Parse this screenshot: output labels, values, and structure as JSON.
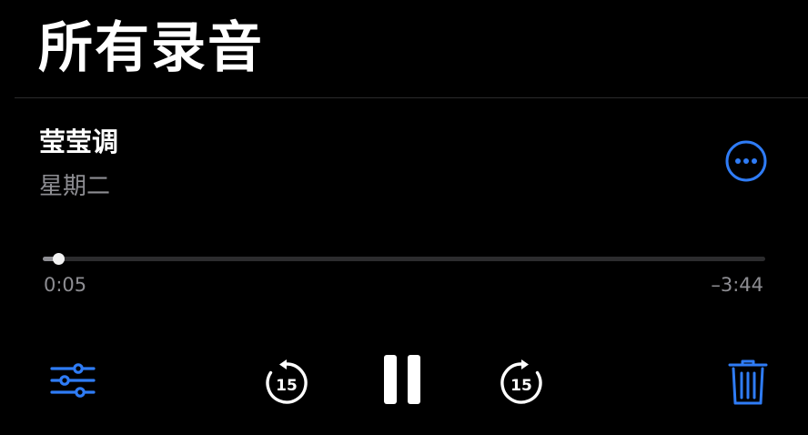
{
  "header": {
    "title": "所有录音"
  },
  "recording": {
    "title": "莹莹调",
    "date": "星期二",
    "more_icon": "ellipsis-circle-icon"
  },
  "playback": {
    "elapsed": "0:05",
    "remaining": "–3:44",
    "progress_fraction": 0.022,
    "skip_back_seconds": "15",
    "skip_forward_seconds": "15"
  },
  "controls": {
    "options_icon": "sliders-icon",
    "skip_back_icon": "skip-back-15-icon",
    "pause_icon": "pause-icon",
    "skip_forward_icon": "skip-forward-15-icon",
    "delete_icon": "trash-icon"
  },
  "colors": {
    "background": "#000000",
    "accent": "#2f7cf6",
    "text_primary": "#ffffff",
    "text_secondary": "#8d8d92"
  }
}
